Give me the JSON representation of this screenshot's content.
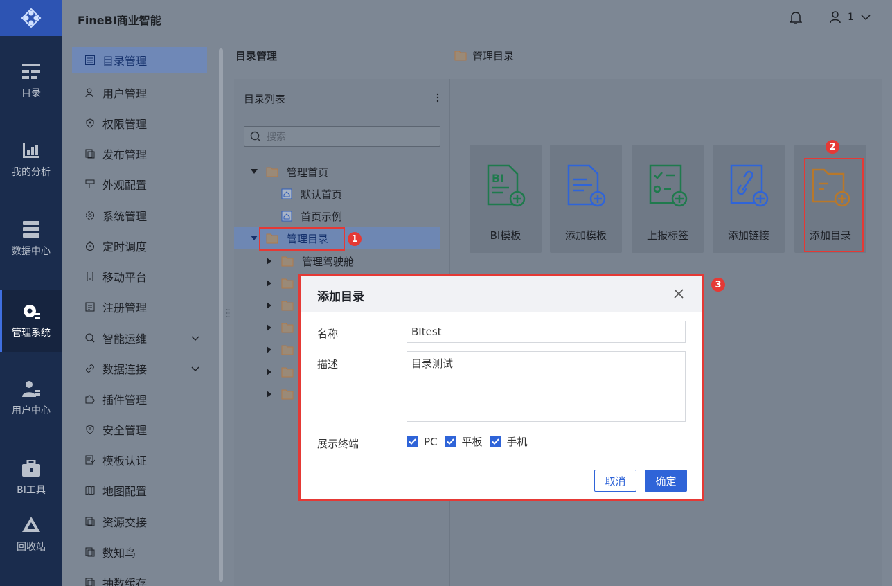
{
  "app": {
    "title": "FineBI商业智能",
    "user": "1"
  },
  "rail": {
    "items": [
      {
        "label": "目录",
        "icon": "catalog-icon"
      },
      {
        "label": "我的分析",
        "icon": "analysis-icon"
      },
      {
        "label": "数据中心",
        "icon": "data-center-icon"
      },
      {
        "label": "管理系统",
        "icon": "gear-icon"
      },
      {
        "label": "用户中心",
        "icon": "user-center-icon"
      },
      {
        "label": "BI工具",
        "icon": "toolbox-icon"
      },
      {
        "label": "回收站",
        "icon": "recycle-icon"
      }
    ],
    "active": "管理系统"
  },
  "menu": {
    "items": [
      {
        "label": "目录管理"
      },
      {
        "label": "用户管理"
      },
      {
        "label": "权限管理"
      },
      {
        "label": "发布管理"
      },
      {
        "label": "外观配置"
      },
      {
        "label": "系统管理"
      },
      {
        "label": "定时调度"
      },
      {
        "label": "移动平台"
      },
      {
        "label": "注册管理"
      },
      {
        "label": "智能运维"
      },
      {
        "label": "数据连接"
      },
      {
        "label": "插件管理"
      },
      {
        "label": "安全管理"
      },
      {
        "label": "模板认证"
      },
      {
        "label": "地图配置"
      },
      {
        "label": "资源交接"
      },
      {
        "label": "数知鸟"
      },
      {
        "label": "抽数缓存"
      }
    ],
    "active": "目录管理"
  },
  "main": {
    "title": "目录管理",
    "tree": {
      "header": "目录列表",
      "search_placeholder": "搜索",
      "nodes": [
        {
          "label": "管理首页"
        },
        {
          "label": "默认首页"
        },
        {
          "label": "首页示例"
        },
        {
          "label": "管理目录"
        },
        {
          "label": "管理驾驶舱"
        }
      ]
    },
    "right": {
      "header": "管理目录",
      "tiles": [
        {
          "label": "BI模板",
          "color": "#1f7a4d"
        },
        {
          "label": "添加模板",
          "color": "#2f64d8"
        },
        {
          "label": "上报标签",
          "color": "#1f7a4d"
        },
        {
          "label": "添加链接",
          "color": "#2f64d8"
        },
        {
          "label": "添加目录",
          "color": "#b8782a"
        }
      ]
    }
  },
  "annotations": {
    "b1": "1",
    "b2": "2",
    "b3": "3"
  },
  "dialog": {
    "title": "添加目录",
    "name_label": "名称",
    "name_value": "BItest",
    "desc_label": "描述",
    "desc_value": "目录测试",
    "terminal_label": "展示终端",
    "terminals": [
      {
        "label": "PC",
        "checked": true
      },
      {
        "label": "平板",
        "checked": true
      },
      {
        "label": "手机",
        "checked": true
      }
    ],
    "cancel_label": "取消",
    "ok_label": "确定"
  },
  "colors": {
    "accent": "#2f64d8",
    "highlight": "#e53935",
    "rail_bg": "#1a2c4d"
  }
}
